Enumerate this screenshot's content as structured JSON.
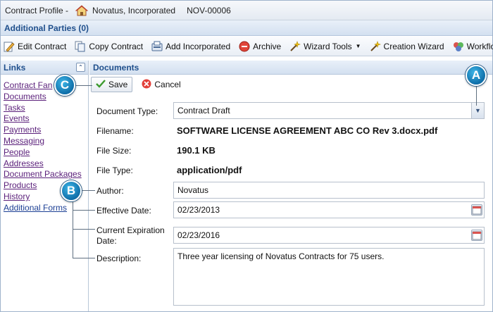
{
  "title": {
    "section": "Contract Profile -",
    "company": "Novatus, Incorporated",
    "record_id": "NOV-00006"
  },
  "parties_bar": {
    "label": "Additional Parties (0)"
  },
  "toolbar": {
    "items": [
      {
        "label": "Edit Contract",
        "icon": "edit-contract-icon"
      },
      {
        "label": "Copy Contract",
        "icon": "copy-contract-icon"
      },
      {
        "label": "Add Incorporated",
        "icon": "add-incorporated-icon"
      },
      {
        "label": "Archive",
        "icon": "archive-icon"
      },
      {
        "label": "Wizard Tools",
        "icon": "wand-icon",
        "dropdown": true
      },
      {
        "label": "Creation Wizard",
        "icon": "wand-icon"
      },
      {
        "label": "Workflows",
        "icon": "workflows-icon"
      }
    ]
  },
  "links_panel": {
    "title": "Links",
    "items": [
      "Contract Fan",
      "Documents",
      "Tasks",
      "Events",
      "Payments",
      "Messaging",
      "People",
      "Addresses",
      "Document Packages",
      "Products",
      "History",
      "Additional Forms"
    ]
  },
  "documents": {
    "title": "Documents",
    "save_label": "Save",
    "cancel_label": "Cancel",
    "fields": {
      "document_type_label": "Document Type:",
      "document_type_value": "Contract Draft",
      "filename_label": "Filename:",
      "filename_value": "SOFTWARE LICENSE AGREEMENT ABC CO Rev 3.docx.pdf",
      "file_size_label": "File Size:",
      "file_size_value": "190.1 KB",
      "file_type_label": "File Type:",
      "file_type_value": "application/pdf",
      "author_label": "Author:",
      "author_value": "Novatus",
      "effective_date_label": "Effective Date:",
      "effective_date_value": "02/23/2013",
      "expiration_label_1": "Current Expiration",
      "expiration_label_2": "Date:",
      "expiration_value": "02/23/2016",
      "description_label": "Description:",
      "description_value": "Three year licensing of Novatus Contracts for 75 users."
    }
  },
  "callouts": {
    "a": "A",
    "b": "B",
    "c": "C"
  },
  "colors": {
    "header_text": "#1f4f8c",
    "link": "#5a1f7a",
    "callout": "#1e88c8"
  }
}
